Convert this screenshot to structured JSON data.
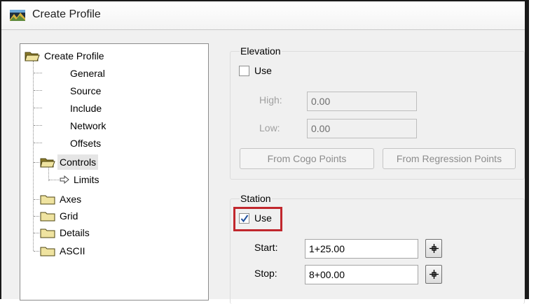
{
  "window": {
    "title": "Create Profile",
    "icon": "profile-app-icon"
  },
  "tree": {
    "root": {
      "label": "Create Profile",
      "icon": "folder-open-icon"
    },
    "items": [
      {
        "label": "General"
      },
      {
        "label": "Source"
      },
      {
        "label": "Include"
      },
      {
        "label": "Network"
      },
      {
        "label": "Offsets"
      },
      {
        "label": "Controls",
        "icon": "folder-open-icon",
        "selected": true
      },
      {
        "label": "Limits",
        "icon": "arrow-right-icon"
      },
      {
        "label": "Axes",
        "icon": "folder-icon"
      },
      {
        "label": "Grid",
        "icon": "folder-icon"
      },
      {
        "label": "Details",
        "icon": "folder-icon"
      },
      {
        "label": "ASCII",
        "icon": "folder-icon"
      }
    ]
  },
  "elevation": {
    "title": "Elevation",
    "use_label": "Use",
    "use_checked": false,
    "high_label": "High:",
    "high_value": "0.00",
    "low_label": "Low:",
    "low_value": "0.00",
    "from_cogo_label": "From Cogo Points",
    "from_regression_label": "From Regression Points"
  },
  "station": {
    "title": "Station",
    "use_label": "Use",
    "use_checked": true,
    "start_label": "Start:",
    "start_value": "1+25.00",
    "stop_label": "Stop:",
    "stop_value": "8+00.00"
  },
  "colors": {
    "highlight": "#c1272d",
    "check": "#1f4f9c"
  }
}
